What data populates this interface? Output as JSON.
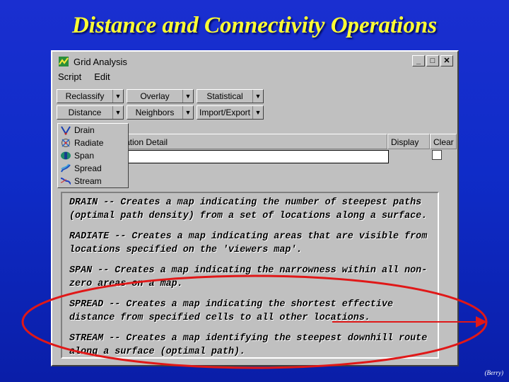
{
  "slide": {
    "title": "Distance and Connectivity Operations",
    "credit": "(Berry)"
  },
  "window": {
    "title": "Grid Analysis",
    "buttons": {
      "minimize": "_",
      "maximize": "□",
      "close": "✕"
    }
  },
  "menu": {
    "script": "Script",
    "edit": "Edit"
  },
  "toolbar": {
    "row1": [
      "Reclassify",
      "Overlay",
      "Statistical"
    ],
    "row2": [
      "Distance",
      "Neighbors",
      "Import/Export"
    ]
  },
  "distance_menu": {
    "items": [
      {
        "label": "Drain",
        "icon": "drain-icon"
      },
      {
        "label": "Radiate",
        "icon": "radiate-icon"
      },
      {
        "label": "Span",
        "icon": "span-icon"
      },
      {
        "label": "Spread",
        "icon": "spread-icon"
      },
      {
        "label": "Stream",
        "icon": "stream-icon"
      }
    ]
  },
  "grid": {
    "col_operation_detail": "ation Detail",
    "col_display": "Display",
    "col_clear": "Clear"
  },
  "descriptions": [
    "DRAIN -- Creates a map indicating the number of steepest paths (optimal path density) from a set of locations along a surface.",
    "RADIATE -- Creates a map indicating areas that are visible from locations specified on the 'viewers map'.",
    "SPAN -- Creates a map indicating the narrowness within all non-zero areas on a map.",
    "SPREAD -- Creates a map indicating the shortest effective distance from specified cells to all other locations.",
    "STREAM -- Creates a map identifying the steepest downhill route along a surface (optimal path)."
  ],
  "colors": {
    "background": "#0f2cc8",
    "title": "#ffff33",
    "highlight": "#e01818"
  }
}
